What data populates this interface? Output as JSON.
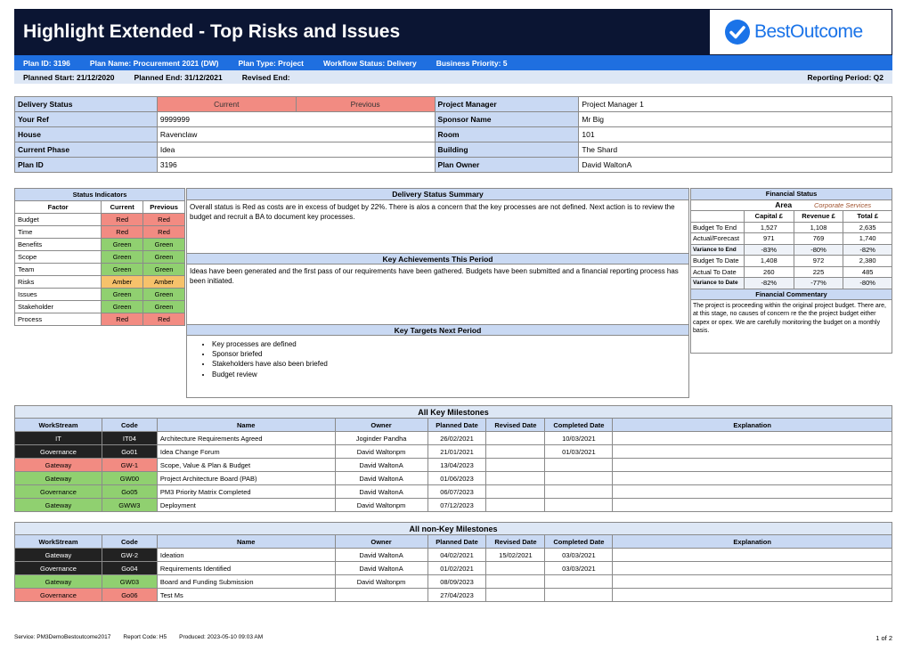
{
  "header": {
    "title": "Highlight Extended - Top Risks and Issues",
    "logo_text": "BestOutcome"
  },
  "plan_bar": {
    "plan_id": "Plan ID: 3196",
    "plan_name": "Plan Name: Procurement 2021 (DW)",
    "plan_type": "Plan Type: Project",
    "workflow_status": "Workflow Status: Delivery",
    "business_priority": "Business Priority: 5"
  },
  "date_bar": {
    "planned_start": "Planned Start: 21/12/2020",
    "planned_end": "Planned End: 31/12/2021",
    "revised_end": "Revised End:",
    "reporting_period": "Reporting Period: Q2"
  },
  "info": {
    "delivery_status_label": "Delivery Status",
    "current_label": "Current",
    "previous_label": "Previous",
    "your_ref_label": "Your Ref",
    "your_ref": "9999999",
    "house_label": "House",
    "house": "Ravenclaw",
    "current_phase_label": "Current Phase",
    "current_phase": "Idea",
    "plan_id_label": "Plan ID",
    "plan_id": "3196",
    "project_manager_label": "Project Manager",
    "project_manager": "Project Manager 1",
    "sponsor_label": "Sponsor Name",
    "sponsor": "Mr Big",
    "room_label": "Room",
    "room": "101",
    "building_label": "Building",
    "building": "The Shard",
    "plan_owner_label": "Plan Owner",
    "plan_owner": "David WaltonA"
  },
  "status_indicators": {
    "title": "Status Indicators",
    "headers": [
      "Factor",
      "Current",
      "Previous"
    ],
    "rows": [
      {
        "factor": "Budget",
        "current": "Red",
        "previous": "Red"
      },
      {
        "factor": "Time",
        "current": "Red",
        "previous": "Red"
      },
      {
        "factor": "Benefits",
        "current": "Green",
        "previous": "Green"
      },
      {
        "factor": "Scope",
        "current": "Green",
        "previous": "Green"
      },
      {
        "factor": "Team",
        "current": "Green",
        "previous": "Green"
      },
      {
        "factor": "Risks",
        "current": "Amber",
        "previous": "Amber"
      },
      {
        "factor": "Issues",
        "current": "Green",
        "previous": "Green"
      },
      {
        "factor": "Stakeholder",
        "current": "Green",
        "previous": "Green"
      },
      {
        "factor": "Process",
        "current": "Red",
        "previous": "Red"
      }
    ]
  },
  "delivery_summary": {
    "title": "Delivery Status Summary",
    "text": "Overall status is Red as costs are in excess of budget by 22%. There is alos a concern that the key processes are not defined. Next action is to review the budget and recruit a BA to document key processes."
  },
  "achievements": {
    "title": "Key Achievements This Period",
    "text": "Ideas have been generated and the first pass of our requirements have been gathered. Budgets have been submitted and a financial reporting process has been initiated."
  },
  "targets": {
    "title": "Key Targets Next Period",
    "items": [
      "Key processes are defined",
      "Sponsor briefed",
      "Stakeholders have also been briefed",
      "Budget review"
    ]
  },
  "financial": {
    "title": "Financial Status",
    "area_label": "Area",
    "area_value": "Corporate Services",
    "headers": [
      "Capital £",
      "Revenue £",
      "Total £"
    ],
    "rows": [
      {
        "label": "Budget To End",
        "capital": "1,527",
        "revenue": "1,108",
        "total": "2,635"
      },
      {
        "label": "Actual/Forecast",
        "capital": "971",
        "revenue": "769",
        "total": "1,740"
      },
      {
        "label": "Variance to End",
        "capital": "-83%",
        "revenue": "-80%",
        "total": "-82%"
      },
      {
        "label": "Budget To Date",
        "capital": "1,408",
        "revenue": "972",
        "total": "2,380"
      },
      {
        "label": "Actual To Date",
        "capital": "260",
        "revenue": "225",
        "total": "485"
      },
      {
        "label": "Variance to Date",
        "capital": "-82%",
        "revenue": "-77%",
        "total": "-80%"
      }
    ],
    "commentary_title": "Financial Commentary",
    "commentary": "The project is proceeding within the original project budget. There are, at this stage, no causes of concern re the the project budget either capex or opex. We are carefully monitoring the budget on a monthly basis."
  },
  "key_milestones": {
    "title": "All Key Milestones",
    "headers": [
      "WorkStream",
      "Code",
      "Name",
      "Owner",
      "Planned Date",
      "Revised Date",
      "Completed Date",
      "Explanation"
    ],
    "rows": [
      {
        "ws": "IT",
        "color": "black",
        "code": "IT04",
        "name": "Architecture Requirements Agreed",
        "owner": "Joginder Pandha",
        "planned": "26/02/2021",
        "revised": "",
        "completed": "10/03/2021",
        "expl": ""
      },
      {
        "ws": "Governance",
        "color": "black",
        "code": "Go01",
        "name": "Idea Change Forum",
        "owner": "David Waltonpm",
        "planned": "21/01/2021",
        "revised": "",
        "completed": "01/03/2021",
        "expl": ""
      },
      {
        "ws": "Gateway",
        "color": "red",
        "code": "GW-1",
        "name": "Scope, Value & Plan & Budget",
        "owner": "David WaltonA",
        "planned": "13/04/2023",
        "revised": "",
        "completed": "",
        "expl": ""
      },
      {
        "ws": "Gateway",
        "color": "green",
        "code": "GW00",
        "name": "Project Architecture Board  (PAB)",
        "owner": "David WaltonA",
        "planned": "01/06/2023",
        "revised": "",
        "completed": "",
        "expl": ""
      },
      {
        "ws": "Governance",
        "color": "green",
        "code": "Go05",
        "name": "PM3 Priority Matrix Completed",
        "owner": "David WaltonA",
        "planned": "06/07/2023",
        "revised": "",
        "completed": "",
        "expl": ""
      },
      {
        "ws": "Gateway",
        "color": "green",
        "code": "GWW3",
        "name": "Deployment",
        "owner": "David Waltonpm",
        "planned": "07/12/2023",
        "revised": "",
        "completed": "",
        "expl": ""
      }
    ]
  },
  "nonkey_milestones": {
    "title": "All non-Key Milestones",
    "headers": [
      "WorkStream",
      "Code",
      "Name",
      "Owner",
      "Planned Date",
      "Revised Date",
      "Completed Date",
      "Explanation"
    ],
    "rows": [
      {
        "ws": "Gateway",
        "color": "black",
        "code": "GW-2",
        "name": "Ideation",
        "owner": "David WaltonA",
        "planned": "04/02/2021",
        "revised": "15/02/2021",
        "completed": "03/03/2021",
        "expl": ""
      },
      {
        "ws": "Governance",
        "color": "black",
        "code": "Go04",
        "name": "Requirements Identified",
        "owner": "David WaltonA",
        "planned": "01/02/2021",
        "revised": "",
        "completed": "03/03/2021",
        "expl": ""
      },
      {
        "ws": "Gateway",
        "color": "green",
        "code": "GW03",
        "name": "Board and Funding Submission",
        "owner": "David Waltonpm",
        "planned": "08/09/2023",
        "revised": "",
        "completed": "",
        "expl": ""
      },
      {
        "ws": "Governance",
        "color": "red",
        "code": "Go06",
        "name": "Test Ms",
        "owner": "",
        "planned": "27/04/2023",
        "revised": "",
        "completed": "",
        "expl": ""
      }
    ]
  },
  "footer": {
    "service": "Service:  PM3DemoBestoutcome2017",
    "report_code": "Report Code:  H5",
    "produced": "Produced:  2023-05-10 09:03 AM",
    "page": "1 of 2"
  },
  "colors": {
    "header_bg": "#0b1533",
    "plan_bar_bg": "#1f6fe0",
    "label_bg": "#c9d9f3",
    "red": "#f28b82",
    "green": "#90d070",
    "amber": "#f6c26b",
    "logo_blue": "#1a73e8"
  }
}
